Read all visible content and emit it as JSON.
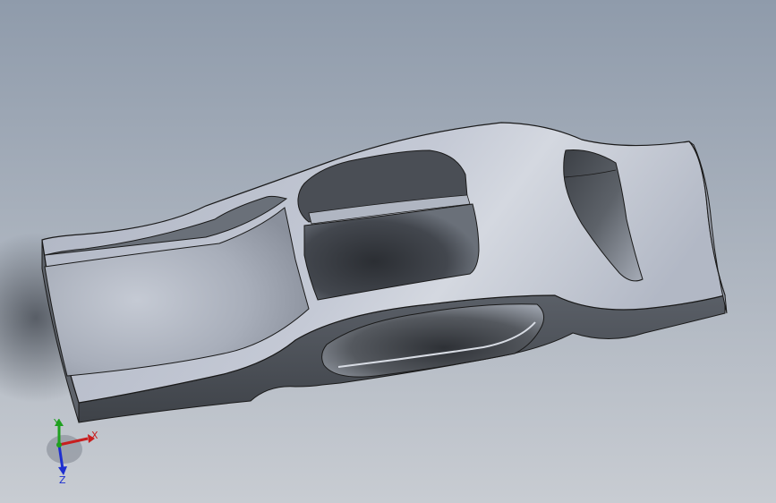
{
  "viewport": {
    "background_top": "#8f9bab",
    "background_bottom": "#c8ccd2"
  },
  "model": {
    "face_color": "#b9bfcc",
    "face_highlight": "#d6dae3",
    "side_color": "#4a4e55",
    "side_light": "#6d727b",
    "cavity_dark": "#2d3035",
    "cavity_mid": "#8e949f",
    "edge_color": "#1a1a1a"
  },
  "triad": {
    "x_label": "X",
    "y_label": "Y",
    "z_label": "Z",
    "x_color": "#c81e1e",
    "y_color": "#1fa01f",
    "z_color": "#1e2fd0"
  }
}
